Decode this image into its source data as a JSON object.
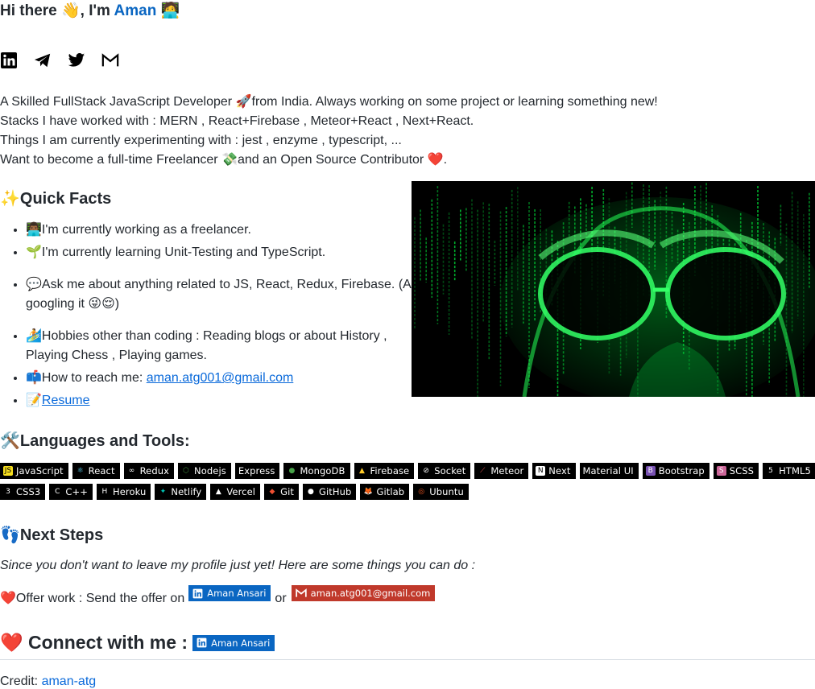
{
  "header": {
    "greeting": "Hi there 👋, I'm",
    "name": "Aman",
    "trail_emoji": "🧑‍💻"
  },
  "socials": [
    {
      "name": "linkedin-icon"
    },
    {
      "name": "telegram-icon"
    },
    {
      "name": "twitter-icon"
    },
    {
      "name": "gmail-icon"
    }
  ],
  "bio": {
    "line1": "A Skilled FullStack JavaScript Developer 🚀from India. Always working on some project or learning something new!",
    "line2": "Stacks I have worked with : MERN , React+Firebase , Meteor+React , Next+React.",
    "line3": "Things I am currently experimenting with : jest , enzyme , typescript, ...",
    "line4": "Want to become a full-time Freelancer 💸and an Open Source Contributor ❤️."
  },
  "quick_facts": {
    "title": "✨Quick Facts",
    "items": [
      "👨🏾‍💻I'm currently working as a freelancer.",
      "🌱I'm currently learning Unit-Testing and TypeScript.",
      "💬Ask me about anything related to JS, React, Redux, Firebase. (After googling it 😜😌)",
      "🏄Hobbies other than coding : Reading blogs or about History , Playing Chess , Playing games.",
      "📫How to reach me: ",
      "📝"
    ],
    "email_link": "aman.atg001@gmail.com",
    "resume_link": "Resume"
  },
  "tools": {
    "title": "🛠️Languages and Tools:",
    "row1": [
      "JavaScript",
      "React",
      "Redux",
      "Nodejs",
      "Express",
      "MongoDB",
      "Firebase",
      "Socket",
      "Meteor",
      "Next",
      "Material UI",
      "Bootstrap",
      "SCSS",
      "HTML5"
    ],
    "row2": [
      "CSS3",
      "C++",
      "Heroku",
      "Netlify",
      "Vercel",
      "Git",
      "GitHub",
      "Gitlab",
      "Ubuntu"
    ]
  },
  "next_steps": {
    "title": "👣Next Steps",
    "intro": "Since you don't want to leave my profile just yet! Here are some things you can do :",
    "offer_prefix": "❤️Offer work : Send the offer on",
    "or": "or",
    "linkedin_badge": "Aman Ansari",
    "gmail_badge": "aman.atg001@gmail.com"
  },
  "connect": {
    "label": "❤️ Connect with me :",
    "linkedin_badge": "Aman Ansari"
  },
  "credit": {
    "prefix": "Credit: ",
    "link": "aman-atg"
  },
  "colors": {
    "accent": "#0a66c2",
    "link": "#0969da",
    "badge_bg": "#000000",
    "gmail": "#c0392b",
    "matrix_green": "#00ff41"
  }
}
